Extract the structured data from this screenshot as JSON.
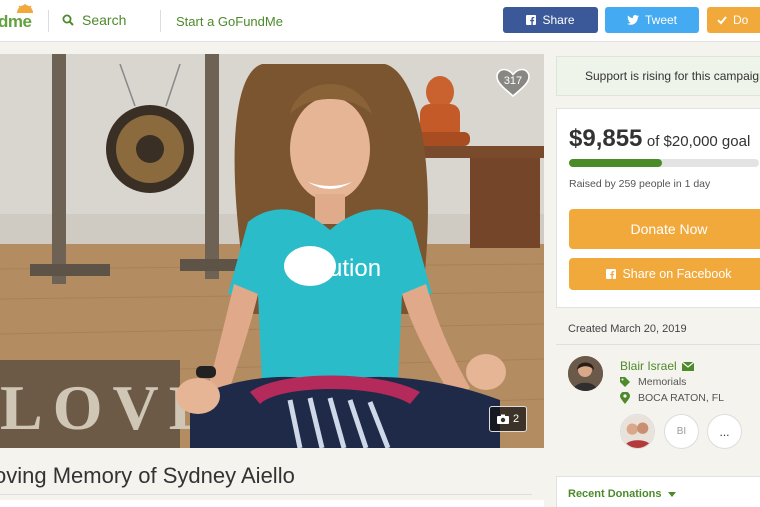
{
  "header": {
    "logo_text": "dme",
    "search_label": "Search",
    "start_label": "Start a GoFundMe",
    "share_label": "Share",
    "tweet_label": "Tweet",
    "donate_label": "Do"
  },
  "hero": {
    "heart_count": "317",
    "photo_count": "2",
    "sign_text": "LOVE",
    "shirt_text": "evolution"
  },
  "campaign": {
    "title": "oving Memory of Sydney Aiello"
  },
  "sidebar": {
    "rising_text": "Support is rising for this campaign",
    "amount_raised": "$9,855",
    "goal_text": "of $20,000 goal",
    "progress_fraction": 0.49,
    "raised_text": "Raised by 259 people in 1 day",
    "donate_now_label": "Donate Now",
    "share_facebook_label": "Share on Facebook",
    "created_text": "Created March 20, 2019",
    "organizer": {
      "name": "Blair Israel",
      "category": "Memorials",
      "location": "BOCA RATON, FL"
    },
    "team_initials": "BI",
    "more_label": "...",
    "recent_donations_label": "Recent Donations"
  },
  "colors": {
    "brand_green": "#4d8a2c",
    "donate_orange": "#f2a93b",
    "facebook_blue": "#3b5998",
    "twitter_blue": "#44aaf1"
  }
}
